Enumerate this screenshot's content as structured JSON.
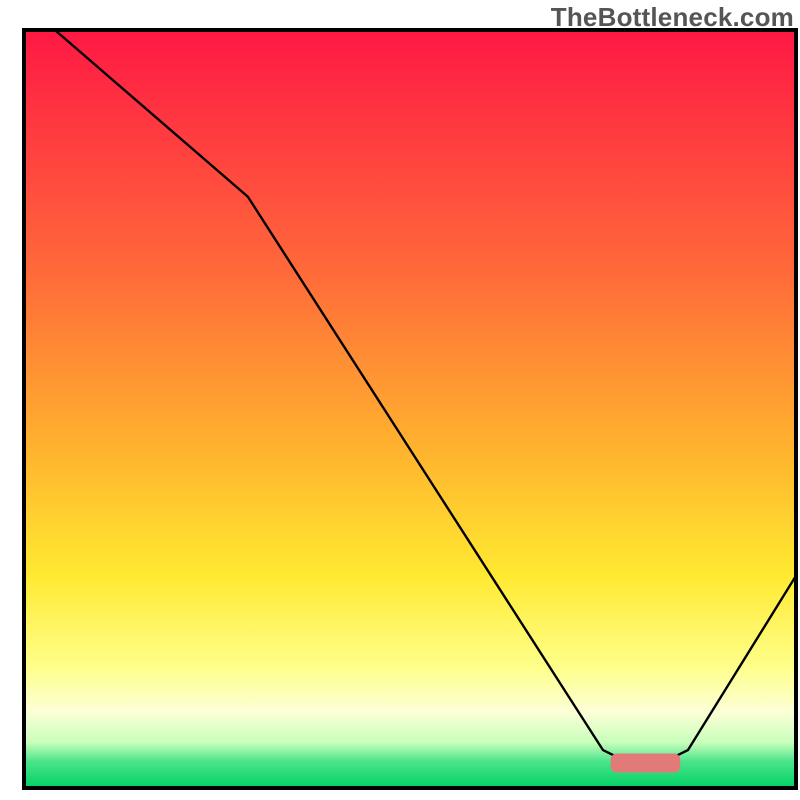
{
  "watermark": "TheBottleneck.com",
  "chart_data": {
    "type": "line",
    "title": "",
    "xlabel": "",
    "ylabel": "",
    "xlim": [
      0,
      100
    ],
    "ylim": [
      0,
      100
    ],
    "background_gradient": {
      "stops": [
        {
          "offset": 0.0,
          "color": "#ff1844"
        },
        {
          "offset": 0.32,
          "color": "#ff6a3a"
        },
        {
          "offset": 0.55,
          "color": "#ffb22e"
        },
        {
          "offset": 0.72,
          "color": "#ffe931"
        },
        {
          "offset": 0.84,
          "color": "#feff8a"
        },
        {
          "offset": 0.9,
          "color": "#fcffd6"
        },
        {
          "offset": 0.94,
          "color": "#c8ffbc"
        },
        {
          "offset": 0.965,
          "color": "#4be48a"
        },
        {
          "offset": 1.0,
          "color": "#00d264"
        }
      ]
    },
    "frame_color": "#000000",
    "series": [
      {
        "name": "bottleneck_curve",
        "color": "#000000",
        "points": [
          {
            "x": 4,
            "y": 100
          },
          {
            "x": 29,
            "y": 78
          },
          {
            "x": 75,
            "y": 5
          },
          {
            "x": 77,
            "y": 4
          },
          {
            "x": 84,
            "y": 4
          },
          {
            "x": 86,
            "y": 5
          },
          {
            "x": 100,
            "y": 28
          }
        ]
      }
    ],
    "markers": [
      {
        "name": "optimum_marker",
        "shape": "roundrect",
        "x_center": 80.5,
        "y": 3.3,
        "width": 9,
        "height": 2.5,
        "color": "#e37a7a"
      }
    ]
  }
}
